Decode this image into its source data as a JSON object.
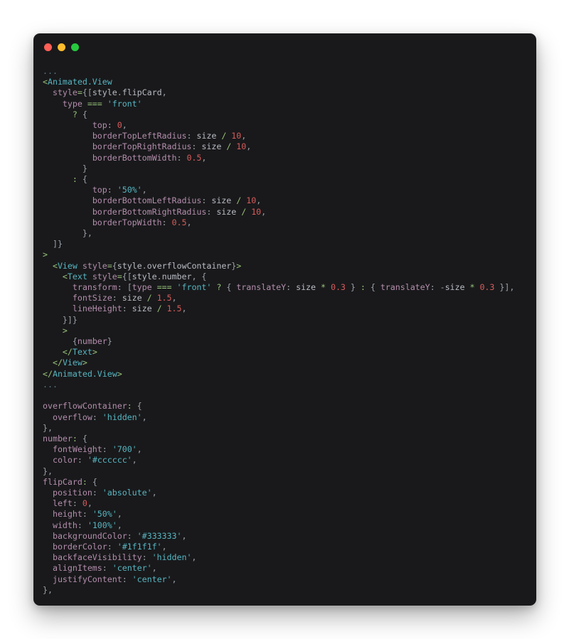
{
  "window": {
    "traffic_lights": [
      {
        "name": "close",
        "color": "#ff5f56"
      },
      {
        "name": "minimize",
        "color": "#ffbd2e"
      },
      {
        "name": "zoom",
        "color": "#27c93f"
      }
    ],
    "background": "#19191b",
    "page_background": "#ffffff"
  },
  "theme": {
    "text": "#c5c8c6",
    "ellipsis": "#5a7c85",
    "tag": "#56b6c2",
    "operator": "#98c379",
    "property": "#b48ead",
    "string": "#56b6c2",
    "number": "#d85c5c",
    "variable": "#b9bcc4",
    "punctuation": "#9aa0a6"
  },
  "code": {
    "language": "jsx",
    "lines": [
      "...",
      "<Animated.View",
      "  style={[style.flipCard,",
      "    type === 'front'",
      "      ? {",
      "          top: 0,",
      "          borderTopLeftRadius: size / 10,",
      "          borderTopRightRadius: size / 10,",
      "          borderBottomWidth: 0.5,",
      "        }",
      "      : {",
      "          top: '50%',",
      "          borderBottomLeftRadius: size / 10,",
      "          borderBottomRightRadius: size / 10,",
      "          borderTopWidth: 0.5,",
      "        },",
      "  ]}",
      ">",
      "  <View style={style.overflowContainer}>",
      "    <Text style={[style.number, {",
      "      transform: [type === 'front' ? { translateY: size * 0.3 } : { translateY: -size * 0.3 }],",
      "      fontSize: size / 1.5,",
      "      lineHeight: size / 1.5,",
      "    }]}",
      "    >",
      "      {number}",
      "    </Text>",
      "  </View>",
      "</Animated.View>",
      "...",
      "",
      "overflowContainer: {",
      "  overflow: 'hidden',",
      "},",
      "number: {",
      "  fontWeight: '700',",
      "  color: '#cccccc',",
      "},",
      "flipCard: {",
      "  position: 'absolute',",
      "  left: 0,",
      "  height: '50%',",
      "  width: '100%',",
      "  backgroundColor: '#333333',",
      "  borderColor: '#1f1f1f',",
      "  backfaceVisibility: 'hidden',",
      "  alignItems: 'center',",
      "  justifyContent: 'center',",
      "},"
    ],
    "string_literals": [
      "'front'",
      "'50%'",
      "'hidden'",
      "'700'",
      "'#cccccc'",
      "'absolute'",
      "'#333333'",
      "'#1f1f1f'",
      "'center'",
      "'100%'"
    ],
    "numeric_literals": [
      "0",
      "10",
      "0.5",
      "0.3",
      "1.5"
    ],
    "components": [
      "Animated.View",
      "View",
      "Text"
    ],
    "style_names": [
      "flipCard",
      "overflowContainer",
      "number"
    ]
  }
}
